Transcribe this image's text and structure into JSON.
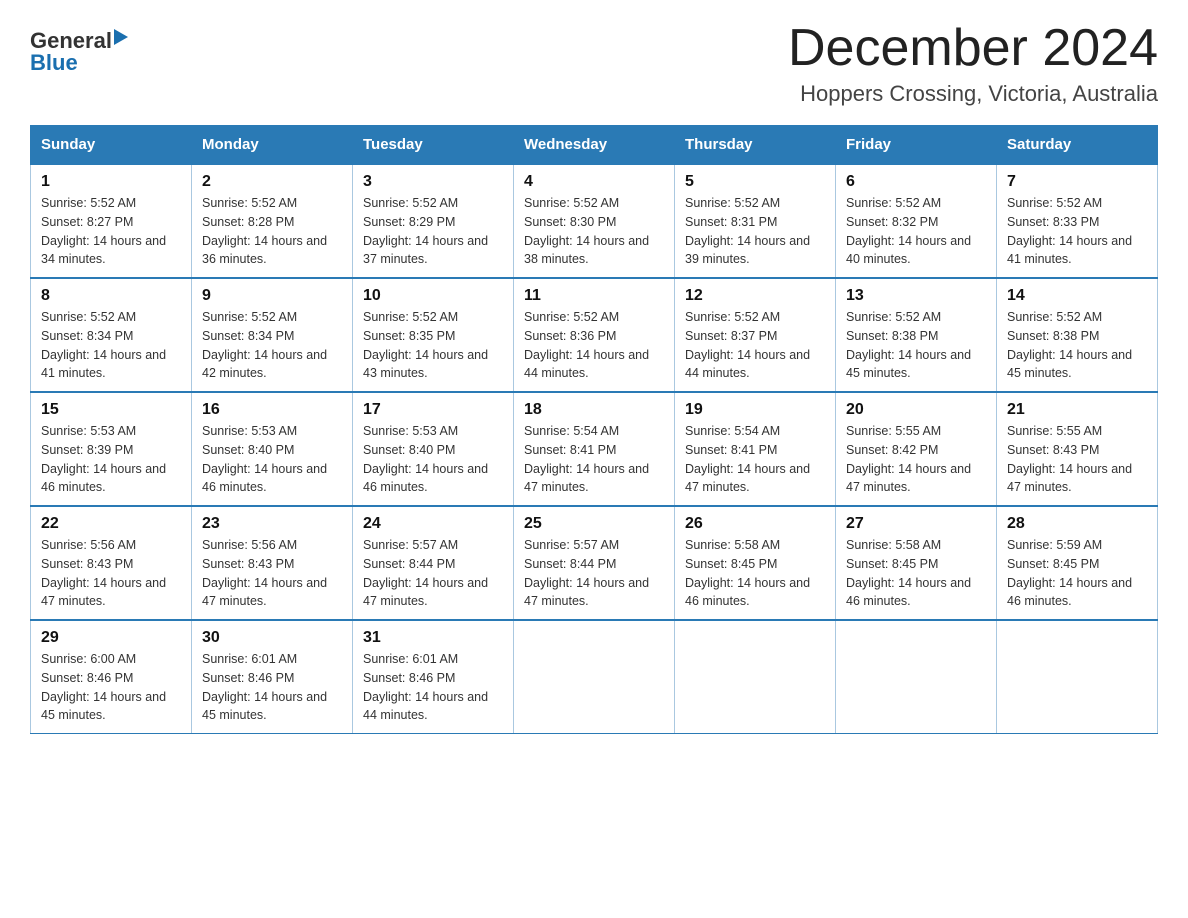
{
  "header": {
    "logo_line1_general": "General",
    "logo_line2_blue": "Blue",
    "month_title": "December 2024",
    "location": "Hoppers Crossing, Victoria, Australia"
  },
  "days_of_week": [
    "Sunday",
    "Monday",
    "Tuesday",
    "Wednesday",
    "Thursday",
    "Friday",
    "Saturday"
  ],
  "weeks": [
    [
      {
        "day": "1",
        "sunrise": "5:52 AM",
        "sunset": "8:27 PM",
        "daylight": "14 hours and 34 minutes."
      },
      {
        "day": "2",
        "sunrise": "5:52 AM",
        "sunset": "8:28 PM",
        "daylight": "14 hours and 36 minutes."
      },
      {
        "day": "3",
        "sunrise": "5:52 AM",
        "sunset": "8:29 PM",
        "daylight": "14 hours and 37 minutes."
      },
      {
        "day": "4",
        "sunrise": "5:52 AM",
        "sunset": "8:30 PM",
        "daylight": "14 hours and 38 minutes."
      },
      {
        "day": "5",
        "sunrise": "5:52 AM",
        "sunset": "8:31 PM",
        "daylight": "14 hours and 39 minutes."
      },
      {
        "day": "6",
        "sunrise": "5:52 AM",
        "sunset": "8:32 PM",
        "daylight": "14 hours and 40 minutes."
      },
      {
        "day": "7",
        "sunrise": "5:52 AM",
        "sunset": "8:33 PM",
        "daylight": "14 hours and 41 minutes."
      }
    ],
    [
      {
        "day": "8",
        "sunrise": "5:52 AM",
        "sunset": "8:34 PM",
        "daylight": "14 hours and 41 minutes."
      },
      {
        "day": "9",
        "sunrise": "5:52 AM",
        "sunset": "8:34 PM",
        "daylight": "14 hours and 42 minutes."
      },
      {
        "day": "10",
        "sunrise": "5:52 AM",
        "sunset": "8:35 PM",
        "daylight": "14 hours and 43 minutes."
      },
      {
        "day": "11",
        "sunrise": "5:52 AM",
        "sunset": "8:36 PM",
        "daylight": "14 hours and 44 minutes."
      },
      {
        "day": "12",
        "sunrise": "5:52 AM",
        "sunset": "8:37 PM",
        "daylight": "14 hours and 44 minutes."
      },
      {
        "day": "13",
        "sunrise": "5:52 AM",
        "sunset": "8:38 PM",
        "daylight": "14 hours and 45 minutes."
      },
      {
        "day": "14",
        "sunrise": "5:52 AM",
        "sunset": "8:38 PM",
        "daylight": "14 hours and 45 minutes."
      }
    ],
    [
      {
        "day": "15",
        "sunrise": "5:53 AM",
        "sunset": "8:39 PM",
        "daylight": "14 hours and 46 minutes."
      },
      {
        "day": "16",
        "sunrise": "5:53 AM",
        "sunset": "8:40 PM",
        "daylight": "14 hours and 46 minutes."
      },
      {
        "day": "17",
        "sunrise": "5:53 AM",
        "sunset": "8:40 PM",
        "daylight": "14 hours and 46 minutes."
      },
      {
        "day": "18",
        "sunrise": "5:54 AM",
        "sunset": "8:41 PM",
        "daylight": "14 hours and 47 minutes."
      },
      {
        "day": "19",
        "sunrise": "5:54 AM",
        "sunset": "8:41 PM",
        "daylight": "14 hours and 47 minutes."
      },
      {
        "day": "20",
        "sunrise": "5:55 AM",
        "sunset": "8:42 PM",
        "daylight": "14 hours and 47 minutes."
      },
      {
        "day": "21",
        "sunrise": "5:55 AM",
        "sunset": "8:43 PM",
        "daylight": "14 hours and 47 minutes."
      }
    ],
    [
      {
        "day": "22",
        "sunrise": "5:56 AM",
        "sunset": "8:43 PM",
        "daylight": "14 hours and 47 minutes."
      },
      {
        "day": "23",
        "sunrise": "5:56 AM",
        "sunset": "8:43 PM",
        "daylight": "14 hours and 47 minutes."
      },
      {
        "day": "24",
        "sunrise": "5:57 AM",
        "sunset": "8:44 PM",
        "daylight": "14 hours and 47 minutes."
      },
      {
        "day": "25",
        "sunrise": "5:57 AM",
        "sunset": "8:44 PM",
        "daylight": "14 hours and 47 minutes."
      },
      {
        "day": "26",
        "sunrise": "5:58 AM",
        "sunset": "8:45 PM",
        "daylight": "14 hours and 46 minutes."
      },
      {
        "day": "27",
        "sunrise": "5:58 AM",
        "sunset": "8:45 PM",
        "daylight": "14 hours and 46 minutes."
      },
      {
        "day": "28",
        "sunrise": "5:59 AM",
        "sunset": "8:45 PM",
        "daylight": "14 hours and 46 minutes."
      }
    ],
    [
      {
        "day": "29",
        "sunrise": "6:00 AM",
        "sunset": "8:46 PM",
        "daylight": "14 hours and 45 minutes."
      },
      {
        "day": "30",
        "sunrise": "6:01 AM",
        "sunset": "8:46 PM",
        "daylight": "14 hours and 45 minutes."
      },
      {
        "day": "31",
        "sunrise": "6:01 AM",
        "sunset": "8:46 PM",
        "daylight": "14 hours and 44 minutes."
      },
      null,
      null,
      null,
      null
    ]
  ],
  "labels": {
    "sunrise": "Sunrise:",
    "sunset": "Sunset:",
    "daylight": "Daylight:"
  },
  "colors": {
    "header_bg": "#2a7ab5",
    "header_text": "#ffffff",
    "border": "#aac8e0"
  }
}
